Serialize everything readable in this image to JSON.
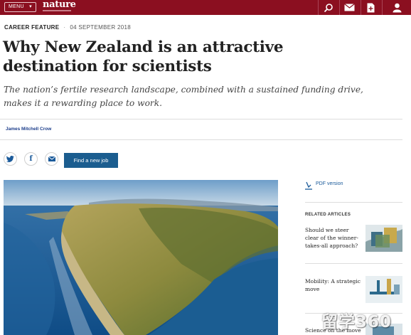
{
  "header": {
    "menu_label": "MENU",
    "logo": "nature",
    "icons": [
      "search-icon",
      "mail-icon",
      "download-icon",
      "account-icon"
    ],
    "brand_color": "#8b0f20"
  },
  "article": {
    "kind": "CAREER FEATURE",
    "date": "04 SEPTEMBER 2018",
    "title": "Why New Zealand is an attractive destination for scientists",
    "standfirst": "The nation’s fertile research landscape, combined with a sustained funding drive, makes it a rewarding place to work.",
    "author": "James Mitchell Crow"
  },
  "share": {
    "buttons": [
      "twitter-icon",
      "facebook-icon",
      "email-icon"
    ],
    "job_button": "Find a new job"
  },
  "sidebar": {
    "pdf_label": "PDF version",
    "related_title": "RELATED ARTICLES",
    "related": [
      {
        "label": "Should we steer clear of the winner-takes-all approach?"
      },
      {
        "label": "Mobility: A strategic move"
      },
      {
        "label": "Science on the move"
      }
    ]
  },
  "watermark": "留学360"
}
